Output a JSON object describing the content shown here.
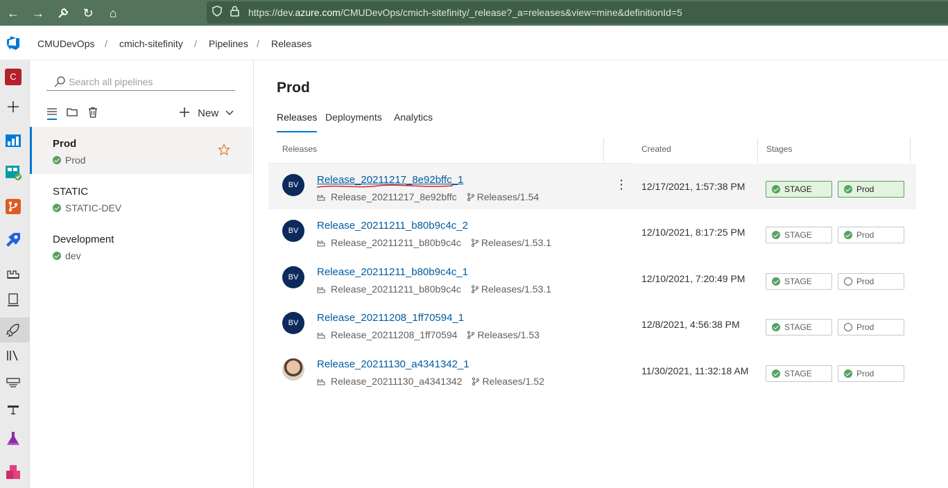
{
  "browser": {
    "url_prefix": "https://dev.",
    "url_domain": "azure.com",
    "url_rest": "/CMUDevOps/cmich-sitefinity/_release?_a=releases&view=mine&definitionId=5"
  },
  "breadcrumb": [
    "CMUDevOps",
    "cmich-sitefinity",
    "Pipelines",
    "Releases"
  ],
  "org_initial": "C",
  "pipelines_panel": {
    "search_placeholder": "Search all pipelines",
    "new_label": "New",
    "items": [
      {
        "name": "Prod",
        "env": "Prod",
        "selected": true
      },
      {
        "name": "STATIC",
        "env": "STATIC-DEV",
        "selected": false
      },
      {
        "name": "Development",
        "env": "dev",
        "selected": false
      }
    ]
  },
  "main": {
    "title": "Prod",
    "tabs": [
      "Releases",
      "Deployments",
      "Analytics"
    ],
    "columns": {
      "releases": "Releases",
      "created": "Created",
      "stages": "Stages"
    },
    "releases": [
      {
        "name": "Release_20211217_8e92bffc_1",
        "build": "Release_20211217_8e92bffc",
        "branch": "Releases/1.54",
        "created": "12/17/2021, 1:57:38 PM",
        "avatar": "BV",
        "stage1": "STAGE",
        "stage2": "Prod",
        "stage1_status": "succeeded",
        "stage2_status": "succeeded"
      },
      {
        "name": "Release_20211211_b80b9c4c_2",
        "build": "Release_20211211_b80b9c4c",
        "branch": "Releases/1.53.1",
        "created": "12/10/2021, 8:17:25 PM",
        "avatar": "BV",
        "stage1": "STAGE",
        "stage2": "Prod",
        "stage1_status": "succeeded",
        "stage2_status": "succeeded"
      },
      {
        "name": "Release_20211211_b80b9c4c_1",
        "build": "Release_20211211_b80b9c4c",
        "branch": "Releases/1.53.1",
        "created": "12/10/2021, 7:20:49 PM",
        "avatar": "BV",
        "stage1": "STAGE",
        "stage2": "Prod",
        "stage1_status": "succeeded",
        "stage2_status": "not deployed"
      },
      {
        "name": "Release_20211208_1ff70594_1",
        "build": "Release_20211208_1ff70594",
        "branch": "Releases/1.53",
        "created": "12/8/2021, 4:56:38 PM",
        "avatar": "BV",
        "stage1": "STAGE",
        "stage2": "Prod",
        "stage1_status": "succeeded",
        "stage2_status": "not deployed"
      },
      {
        "name": "Release_20211130_a4341342_1",
        "build": "Release_20211130_a4341342",
        "branch": "Releases/1.52",
        "created": "11/30/2021, 11:32:18 AM",
        "avatar": "",
        "stage1": "STAGE",
        "stage2": "Prod",
        "stage1_status": "succeeded",
        "stage2_status": "succeeded"
      }
    ]
  },
  "colors": {
    "accent": "#0078d4",
    "link": "#005ba1",
    "success": "#55a362",
    "browser_bar": "#53735a"
  }
}
